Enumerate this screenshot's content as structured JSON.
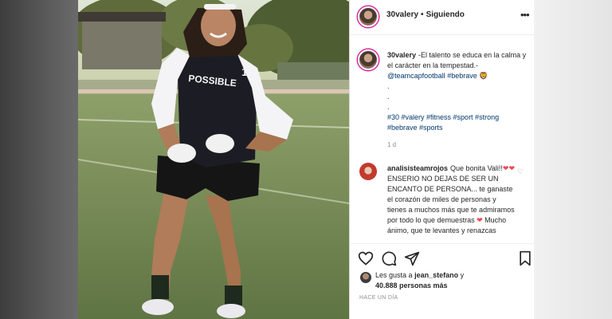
{
  "post": {
    "username": "30valery",
    "follow_status": "Siguiendo",
    "caption": {
      "text": "-El talento se educa en la calma y el carácter en la tempestad.-",
      "mention": "@teamcapfootball",
      "tag1": "#bebrave",
      "emoji": "🦁",
      "dot1": ".",
      "dot2": ".",
      "dot3": ".",
      "hashtags_line1": "#30 #valery #fitness #sport #strong",
      "hashtags_line2": "#bebrave #sports"
    },
    "time_short": "1 d",
    "comment": {
      "username": "analisisteamrojos",
      "text1": "Que bonita Vali!!",
      "text2": "ENSERIO NO DEJAS DE SER UN ENCANTO DE PERSONA... te ganaste el corazón de miles de personas y tienes a muchos más que te admiramos por todo lo que demuestras",
      "text3": "Mucho ánimo, que te levantes y renazcas"
    },
    "likes": {
      "prefix": "Les gusta a",
      "user": "jean_stefano",
      "and": "y",
      "count": "40.888 personas más"
    },
    "time_ago": "HACE UN DÍA",
    "jersey_text": "POSSIBLE",
    "jersey_number": "1"
  },
  "icons": {
    "more": "more-icon",
    "like": "heart-icon",
    "comment": "comment-icon",
    "share": "share-icon",
    "save": "bookmark-icon"
  },
  "colors": {
    "link": "#00376b",
    "heart": "#ed4956",
    "ring": "#d6249f"
  }
}
